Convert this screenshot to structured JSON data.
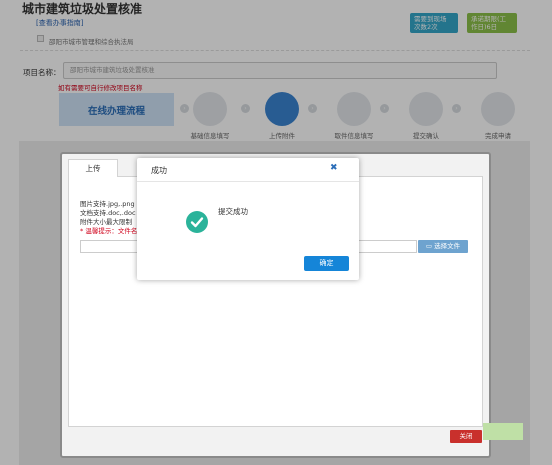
{
  "page": {
    "title": "城市建筑垃圾处置核准",
    "guide_link": "[查看办事指南]",
    "department": "邵阳市城市管理和综合执法局",
    "badges": [
      {
        "line1": "需要到现场",
        "line2": "次数2次"
      },
      {
        "line1": "承诺期限(工",
        "line2": "作日)6日"
      }
    ]
  },
  "project": {
    "label": "项目名称：",
    "value": "邵阳市城市建筑垃圾处置核准",
    "hint": "如有需要可自行修改项目名称"
  },
  "flow": {
    "title": "在线办理流程",
    "steps": [
      {
        "label": "基础信息填写"
      },
      {
        "label": "上传附件"
      },
      {
        "label": "取件信息填写"
      },
      {
        "label": "提交确认"
      },
      {
        "label": "完成申请"
      }
    ]
  },
  "upload_modal": {
    "tab": "上传",
    "lines": [
      "图片支持.jpg,.png",
      "文档支持.doc,.doc",
      "附件大小最大限制",
      "* 温馨提示：文件名"
    ],
    "select_button": "选择文件",
    "close_button": "关闭"
  },
  "success_dialog": {
    "title": "成功",
    "message": "提交成功",
    "confirm": "确定"
  },
  "colors": {
    "primary": "#1585d8",
    "success": "#2bb39a",
    "danger": "#c9302c",
    "step_active": "#3a84d1"
  }
}
